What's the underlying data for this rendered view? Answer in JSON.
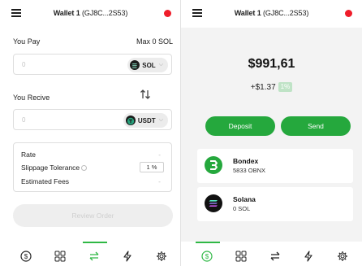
{
  "left": {
    "header": {
      "wallet_name": "Wallet 1",
      "wallet_address": "(GJ8C...2S53)",
      "status_color": "#ef1d2a"
    },
    "swap": {
      "you_pay_label": "You Pay",
      "max_label": "Max 0 SOL",
      "pay_amount_placeholder": "0",
      "pay_token": {
        "symbol": "SOL",
        "icon": "solana-icon"
      },
      "you_receive_label": "You Recive",
      "receive_amount_placeholder": "0",
      "receive_token": {
        "symbol": "USDT",
        "icon": "tether-icon"
      },
      "switch_icon": "swap-arrows-icon"
    },
    "details": {
      "rate_label": "Rate",
      "rate_value": "-",
      "slippage_label": "Slippage Tolerance",
      "slippage_value": "1 %",
      "fees_label": "Estimated Fees",
      "fees_value": "-"
    },
    "review_button_label": "Review Order",
    "nav": {
      "active": "swap",
      "items": [
        "wallet-icon",
        "apps-grid-icon",
        "swap-icon",
        "lightning-icon",
        "settings-icon"
      ]
    }
  },
  "right": {
    "header": {
      "wallet_name": "Wallet 1",
      "wallet_address": "(GJ8C...2S53)",
      "status_color": "#ef1d2a"
    },
    "balance": "$991,61",
    "change": "+$1.37",
    "change_percent": "1%",
    "deposit_label": "Deposit",
    "send_label": "Send",
    "assets": [
      {
        "name": "Bondex",
        "amount": "5833 OBNX",
        "icon": "bondex-logo-icon"
      },
      {
        "name": "Solana",
        "amount": "0 SOL",
        "icon": "solana-logo-icon"
      }
    ],
    "nav": {
      "active": "wallet",
      "items": [
        "wallet-icon",
        "apps-grid-icon",
        "swap-icon",
        "lightning-icon",
        "settings-icon"
      ]
    }
  },
  "colors": {
    "accent": "#25a83d",
    "nav_active": "#2fb845",
    "status": "#ef1d2a"
  }
}
